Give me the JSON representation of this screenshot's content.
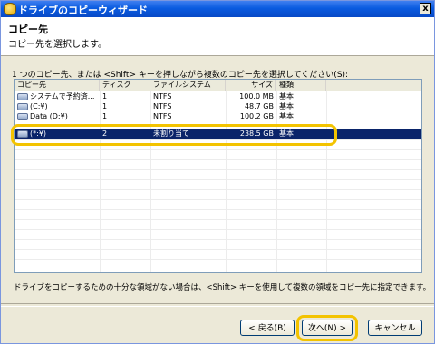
{
  "window": {
    "title": "ドライブのコピーウィザード",
    "close_label": "x"
  },
  "header": {
    "title": "コピー先",
    "subtitle": "コピー先を選択します。"
  },
  "instruction": "1 つのコピー先、または <Shift> キーを押しながら複数のコピー先を選択してください(S):",
  "table": {
    "columns": [
      "コピー先",
      "ディスク",
      "ファイルシステム",
      "サイズ",
      "種類"
    ],
    "rows": [
      [
        "システムで予約済...",
        "1",
        "NTFS",
        "100.0 MB",
        "基本"
      ],
      [
        "(C:¥)",
        "1",
        "NTFS",
        "48.7 GB",
        "基本"
      ],
      [
        "Data (D:¥)",
        "1",
        "NTFS",
        "100.2 GB",
        "基本"
      ],
      [
        "(*:¥)",
        "2",
        "未割り当て",
        "238.5 GB",
        "基本"
      ]
    ],
    "selected_index": 3
  },
  "note": "ドライブをコピーするための十分な領域がない場合は、<Shift> キーを使用して複数の領域をコピー先に指定できます。",
  "buttons": {
    "back": "< 戻る(B)",
    "next": "次へ(N) >",
    "cancel": "キャンセル"
  },
  "colors": {
    "selection": "#0a246a",
    "highlight": "#f3c300",
    "titlebar": "#0a5be0"
  }
}
